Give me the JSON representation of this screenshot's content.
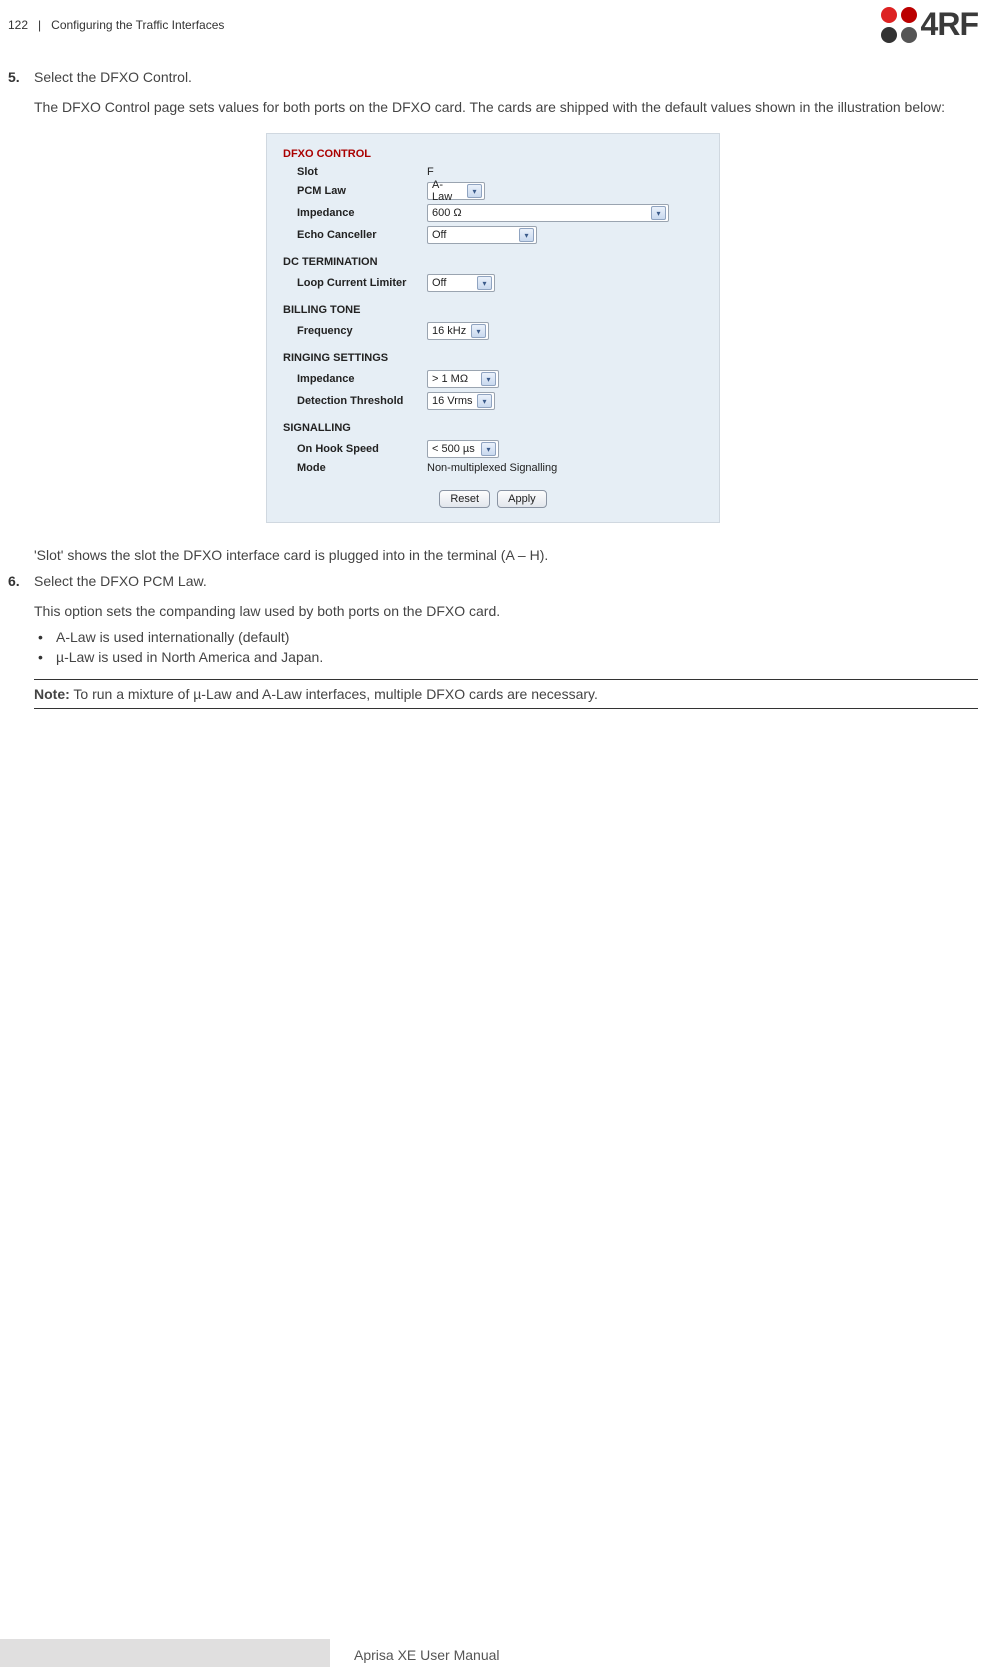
{
  "header": {
    "page_number": "122",
    "section": "Configuring the Traffic Interfaces",
    "logo_text": "4RF"
  },
  "steps": [
    {
      "num": "5.",
      "lead": "Select the DFXO Control.",
      "para": "The DFXO Control page sets values for both ports on the DFXO card. The cards are shipped with the default values shown in the illustration below:"
    },
    {
      "num": "6.",
      "lead": "Select the DFXO PCM Law.",
      "para": "This option sets the companding law used by both ports on the DFXO card."
    }
  ],
  "post_ui_para": "'Slot' shows the slot the DFXO interface card is plugged into in the terminal (A – H).",
  "bullets": [
    "A-Law is used internationally (default)",
    "µ-Law is used in North America and Japan."
  ],
  "note": {
    "label": "Note:",
    "text": " To run a mixture of µ-Law and A-Law interfaces, multiple DFXO cards are necessary."
  },
  "ui": {
    "title": "DFXO CONTROL",
    "sections": {
      "main": [
        {
          "label": "Slot",
          "type": "text",
          "value": "F"
        },
        {
          "label": "PCM Law",
          "type": "select",
          "value": "A-Law",
          "width": "w1"
        },
        {
          "label": "Impedance",
          "type": "select",
          "value": "600 Ω",
          "width": "w2"
        },
        {
          "label": "Echo Canceller",
          "type": "select",
          "value": "Off",
          "width": "w3"
        }
      ],
      "dc_termination": {
        "heading": "DC TERMINATION",
        "rows": [
          {
            "label": "Loop Current Limiter",
            "type": "select",
            "value": "Off",
            "width": "w4"
          }
        ]
      },
      "billing_tone": {
        "heading": "BILLING TONE",
        "rows": [
          {
            "label": "Frequency",
            "type": "select",
            "value": "16 kHz",
            "width": "w5"
          }
        ]
      },
      "ringing_settings": {
        "heading": "RINGING SETTINGS",
        "rows": [
          {
            "label": "Impedance",
            "type": "select",
            "value": "> 1 MΩ",
            "width": "w6"
          },
          {
            "label": "Detection Threshold",
            "type": "select",
            "value": "16 Vrms",
            "width": "w7"
          }
        ]
      },
      "signalling": {
        "heading": "SIGNALLING",
        "rows": [
          {
            "label": "On Hook Speed",
            "type": "select",
            "value": "< 500 µs",
            "width": "w8"
          },
          {
            "label": "Mode",
            "type": "text",
            "value": "Non-multiplexed Signalling"
          }
        ]
      }
    },
    "buttons": {
      "reset": "Reset",
      "apply": "Apply"
    }
  },
  "footer": {
    "text": "Aprisa XE User Manual"
  }
}
